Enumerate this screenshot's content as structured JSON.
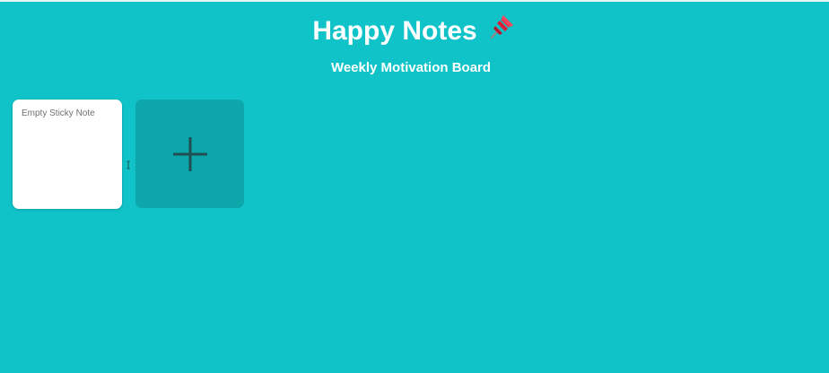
{
  "header": {
    "title": "Happy Notes",
    "title_icon": "pushpin-icon",
    "subtitle": "Weekly Motivation Board"
  },
  "notes": [
    {
      "placeholder": "Empty Sticky Note",
      "value": ""
    }
  ],
  "add_button": {
    "icon": "plus-icon"
  },
  "colors": {
    "background": "#10c3c9",
    "add_button": "#0da6ab",
    "note": "#ffffff",
    "title_text": "#ffffff"
  }
}
